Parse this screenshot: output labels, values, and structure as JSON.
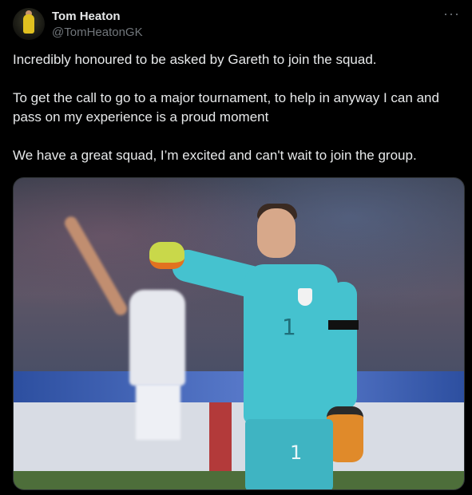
{
  "tweet": {
    "author": {
      "name": "Tom Heaton",
      "handle": "@TomHeatonGK",
      "avatar_icon": "avatar-photo"
    },
    "more_label": "···",
    "paragraphs": [
      "Incredibly honoured to be asked by Gareth to join the squad.",
      "To get the call to go to a major tournament, to help in anyway I can and pass on my experience is a proud moment",
      "We have a great squad, I’m excited and can't wait to join the group."
    ],
    "media": {
      "shirt_number": "1",
      "shorts_number": "1"
    }
  },
  "colors": {
    "background": "#000000",
    "text_primary": "#e7e9ea",
    "text_secondary": "#71767b",
    "goalkeeper_kit": "#45c2cf"
  }
}
